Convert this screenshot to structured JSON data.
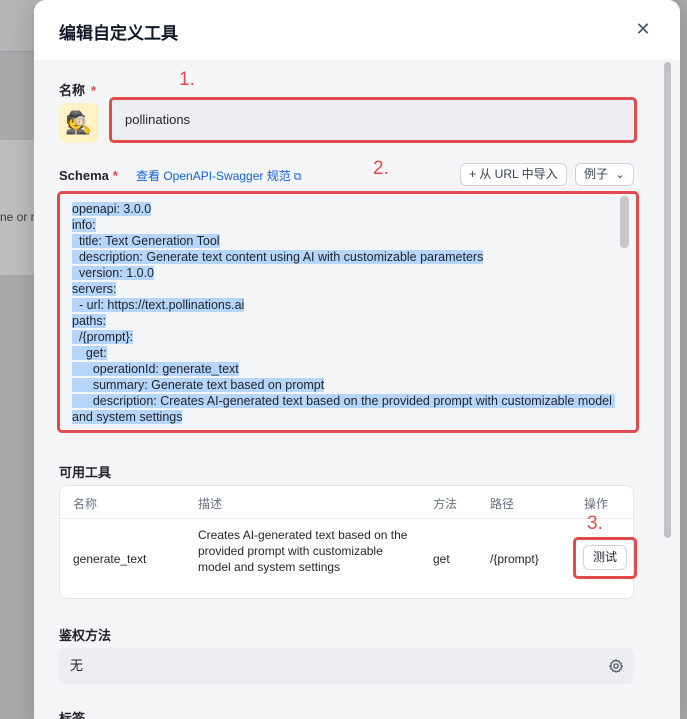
{
  "backdrop": {
    "partial_text": "ne or m"
  },
  "modal": {
    "title": "编辑自定义工具",
    "close_icon": "close-icon"
  },
  "name_field": {
    "label": "名称",
    "required_mark": "*",
    "avatar_emoji": "🕵️",
    "value": "pollinations"
  },
  "schema": {
    "label": "Schema",
    "required_mark": "*",
    "link_text": "查看 OpenAPI-Swagger 规范",
    "link_icon": "external-link-icon",
    "import_button": "+ 从 URL 中导入",
    "example_button": "例子",
    "example_chevron": "⌄",
    "lines": [
      "openapi: 3.0.0",
      "info:",
      "  title: Text Generation Tool",
      "  description: Generate text content using AI with customizable parameters",
      "  version: 1.0.0",
      "servers:",
      "  - url: https://text.pollinations.ai",
      "paths:",
      "  /{prompt}:",
      "    get:",
      "      operationId: generate_text",
      "      summary: Generate text based on prompt",
      "      description: Creates AI-generated text based on the provided prompt with customizable model and system settings"
    ]
  },
  "tools": {
    "section_label": "可用工具",
    "columns": [
      "名称",
      "描述",
      "方法",
      "路径",
      "操作"
    ],
    "rows": [
      {
        "name": "generate_text",
        "description": "Creates AI-generated text based on the provided prompt with customizable model and system settings",
        "method": "get",
        "path": "/{prompt}",
        "action": "测试"
      }
    ]
  },
  "auth": {
    "section_label": "鉴权方法",
    "value": "无",
    "icon": "gear-icon"
  },
  "tags": {
    "section_label": "标签"
  },
  "annotations": [
    "1.",
    "2.",
    "3."
  ],
  "colors": {
    "annotation_red": "#e14b4b",
    "link_blue": "#1660d8",
    "selection_blue": "#b5d5fb"
  }
}
